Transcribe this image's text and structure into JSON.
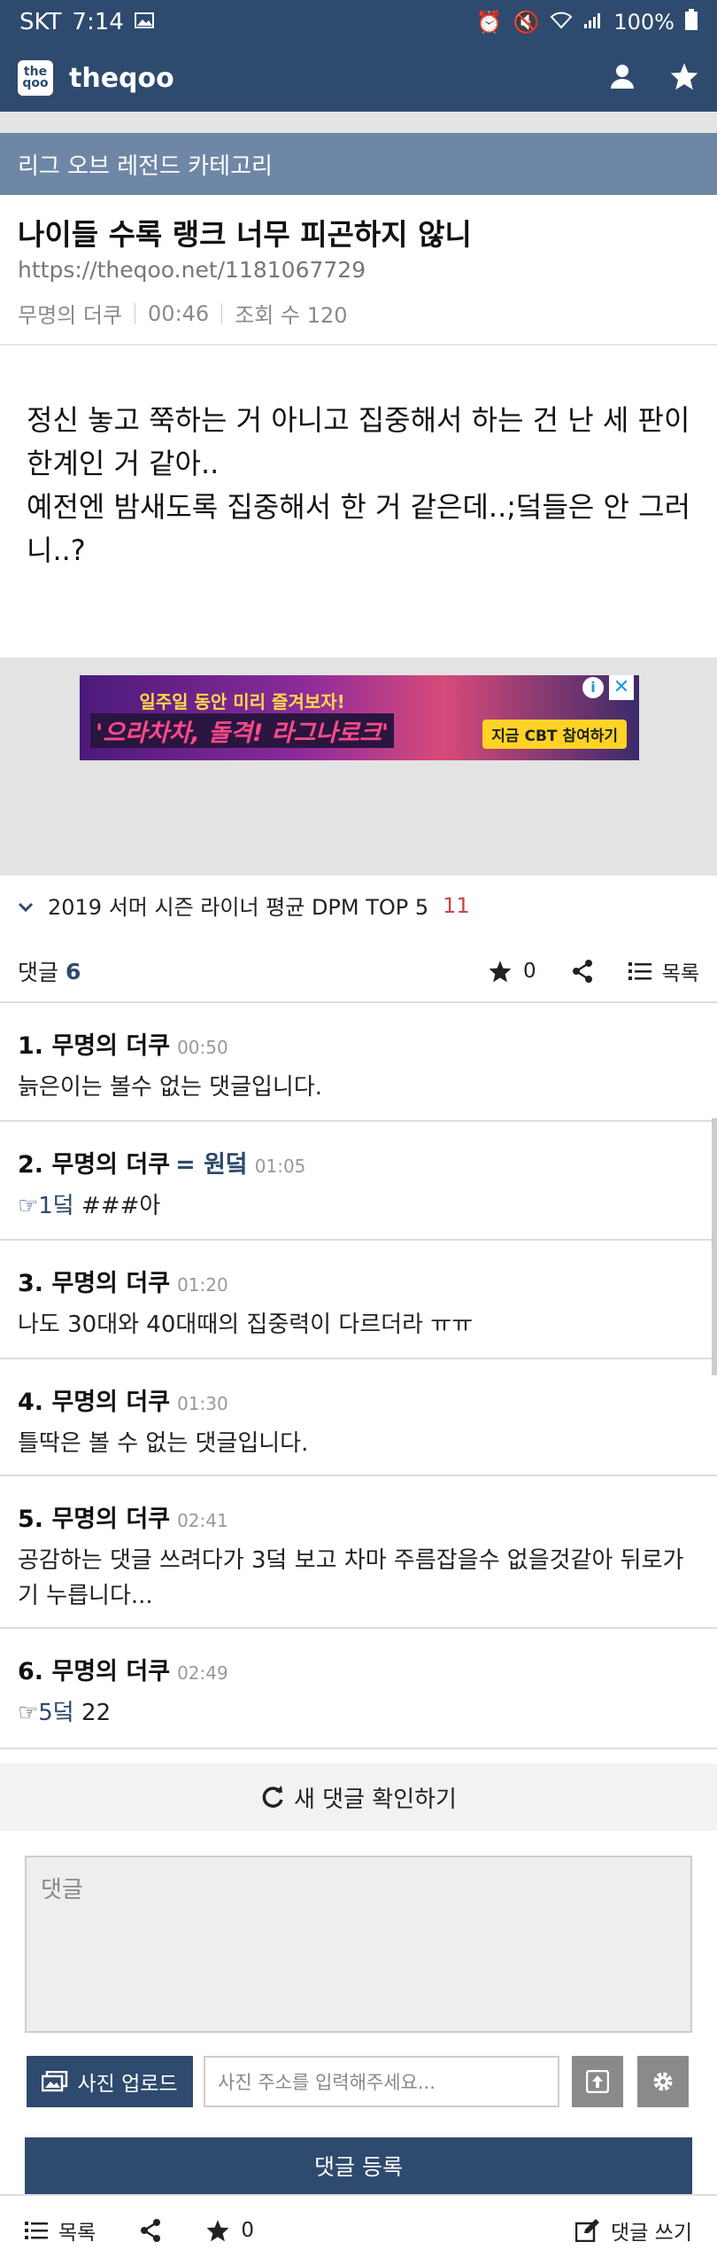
{
  "statusbar": {
    "carrier": "SKT",
    "time": "7:14",
    "battery": "100%"
  },
  "appbar": {
    "brand": "theqoo",
    "logo_text": "the qoo"
  },
  "category": {
    "label": "리그 오브 레전드 카테고리"
  },
  "post": {
    "title": "나이들 수록 랭크 너무 피곤하지 않니",
    "url": "https://theqoo.net/1181067729",
    "author": "무명의 더쿠",
    "time": "00:46",
    "views": "조회 수 120",
    "body": "정신 놓고 쭉하는 거 아니고 집중해서 하는 건 난 세 판이 한계인 거 같아..\n예전엔 밤새도록 집중해서 한 거 같은데..;덬들은 안 그러니..?"
  },
  "ad": {
    "line1": "일주일 동안 미리 즐겨보자!",
    "line2": "'으라차차, 돌격! 라그나로크'",
    "cta": "지금 CBT 참여하기"
  },
  "related": {
    "title": "2019 서머 시즌 라이너 평균 DPM TOP 5",
    "count": "11"
  },
  "comments_header": {
    "label": "댓글",
    "count": "6",
    "star_count": "0",
    "list_label": "목록"
  },
  "comments": [
    {
      "no": "1.",
      "author": "무명의 더쿠",
      "rank": "",
      "time": "00:50",
      "ref": "",
      "text": "늙은이는 볼수 없는 댓글입니다."
    },
    {
      "no": "2.",
      "author": "무명의 더쿠",
      "rank": "= 원덬",
      "time": "01:05",
      "ref": "☞1덬",
      "text": " ###아"
    },
    {
      "no": "3.",
      "author": "무명의 더쿠",
      "rank": "",
      "time": "01:20",
      "ref": "",
      "text": "나도 30대와 40대때의 집중력이 다르더라 ㅠㅠ"
    },
    {
      "no": "4.",
      "author": "무명의 더쿠",
      "rank": "",
      "time": "01:30",
      "ref": "",
      "text": "틀딱은 볼 수 없는 댓글입니다."
    },
    {
      "no": "5.",
      "author": "무명의 더쿠",
      "rank": "",
      "time": "02:41",
      "ref": "",
      "text": "공감하는 댓글 쓰려다가 3덬 보고 차마 주름잡을수 없을것같아 뒤로가기 누릅니다..."
    },
    {
      "no": "6.",
      "author": "무명의 더쿠",
      "rank": "",
      "time": "02:49",
      "ref": "☞5덬",
      "text": " 22"
    }
  ],
  "refresh_label": "새 댓글 확인하기",
  "comment_form": {
    "placeholder": "댓글",
    "upload_label": "사진 업로드",
    "url_placeholder": "사진 주소를 입력해주세요...",
    "submit_label": "댓글 등록"
  },
  "bottombar": {
    "list_label": "목록",
    "star_count": "0",
    "write_label": "댓글 쓰기"
  }
}
